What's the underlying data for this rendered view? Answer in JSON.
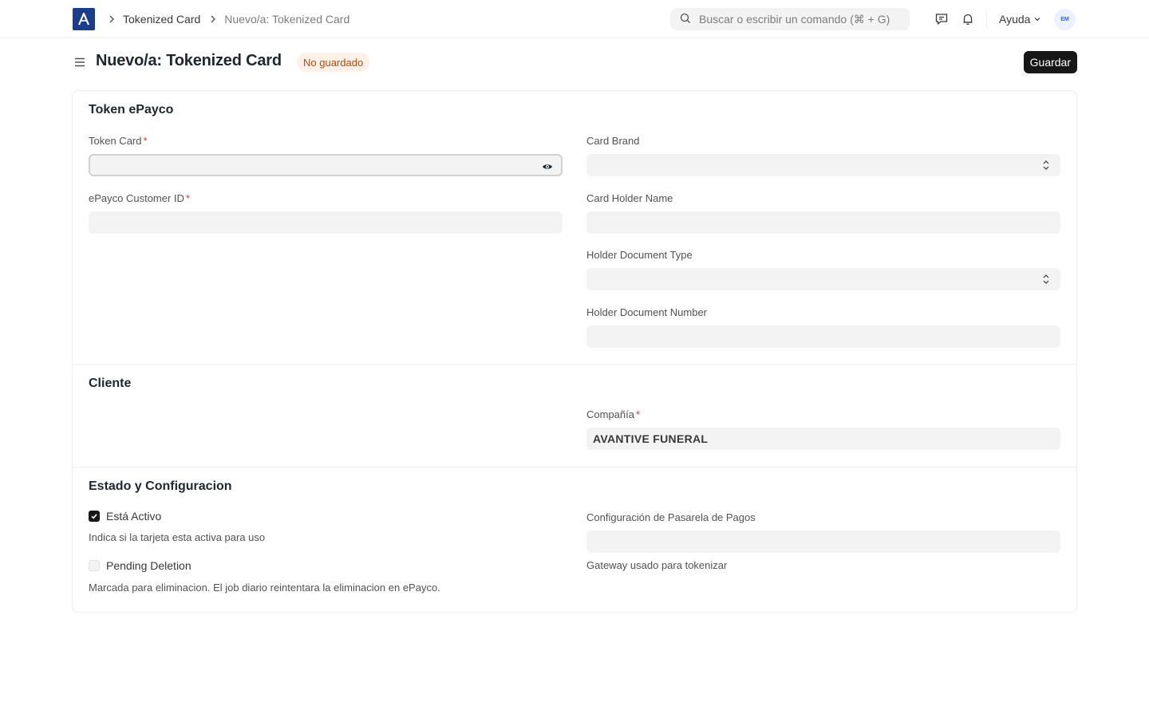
{
  "navbar": {
    "breadcrumbs": [
      "Tokenized Card",
      "Nuevo/a: Tokenized Card"
    ],
    "search_placeholder": "Buscar o escribir un comando (⌘ + G)",
    "help_label": "Ayuda",
    "avatar_initials": "EM"
  },
  "page": {
    "title": "Nuevo/a: Tokenized Card",
    "status": "No guardado",
    "save_label": "Guardar"
  },
  "sections": {
    "token": {
      "title": "Token ePayco",
      "token_card_label": "Token Card",
      "customer_id_label": "ePayco Customer ID",
      "card_brand_label": "Card Brand",
      "holder_name_label": "Card Holder Name",
      "doc_type_label": "Holder Document Type",
      "doc_number_label": "Holder Document Number"
    },
    "cliente": {
      "title": "Cliente",
      "company_label": "Compañía",
      "company_value": "AVANTIVE FUNERAL"
    },
    "estado": {
      "title": "Estado y Configuracion",
      "active_label": "Está Activo",
      "active_checked": true,
      "active_desc": "Indica si la tarjeta esta activa para uso",
      "pending_label": "Pending Deletion",
      "pending_checked": false,
      "pending_desc": "Marcada para eliminacion. El job diario reintentara la eliminacion en ePayco.",
      "gateway_label": "Configuración de Pasarela de Pagos",
      "gateway_desc": "Gateway usado para tokenizar"
    }
  },
  "colors": {
    "brand": "#1c3d8c",
    "primary_button": "#171717",
    "status_bg": "#fff1e7",
    "status_text": "#b6490c",
    "required": "#e03636",
    "input_bg": "#f3f3f3"
  },
  "icons": [
    "app-logo",
    "chevron-right-icon",
    "search-icon",
    "comment-icon",
    "bell-icon",
    "chevron-down-icon",
    "menu-icon",
    "eye-icon",
    "select-updown-icon",
    "check-icon"
  ]
}
